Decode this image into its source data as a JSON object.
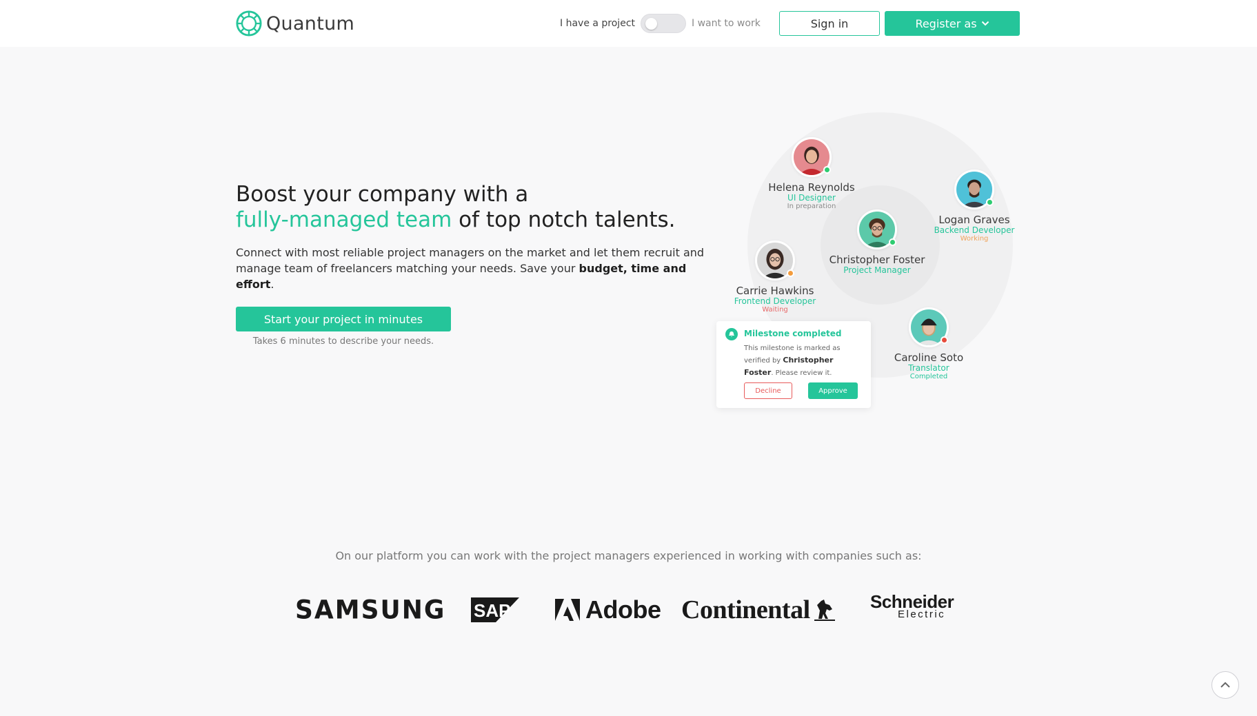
{
  "header": {
    "brand": "Quantum",
    "toggle_left": "I have a project",
    "toggle_right": "I want to work",
    "signin_label": "Sign in",
    "register_label": "Register as"
  },
  "hero": {
    "title_part1": "Boost your company with a",
    "title_accent": "fully-managed team",
    "title_part2": " of top notch talents.",
    "desc_part1": "Connect with most reliable project managers on the market and let them recruit and manage team of freelancers matching your needs. Save your ",
    "desc_bold": "budget, time and effort",
    "desc_end": ".",
    "cta_label": "Start your project in minutes",
    "cta_note": "Takes 6 minutes to describe your needs."
  },
  "people": [
    {
      "name": "Helena Reynolds",
      "role": "UI Designer",
      "state": "In preparation",
      "state_color": "#8a8a8a",
      "status_color": "#2ecc71"
    },
    {
      "name": "Logan Graves",
      "role": "Backend Developer",
      "state": "Working",
      "state_color": "#f0a35a",
      "status_color": "#2ecc71"
    },
    {
      "name": "Christopher Foster",
      "role": "Project Manager",
      "state": "",
      "state_color": "#8a8a8a",
      "status_color": "#2ecc71"
    },
    {
      "name": "Carrie Hawkins",
      "role": "Frontend Developer",
      "state": "Waiting",
      "state_color": "#e86a6a",
      "status_color": "#f39c3d"
    },
    {
      "name": "Caroline Soto",
      "role": "Translator",
      "state": "Completed",
      "state_color": "#25c59a",
      "status_color": "#e74c3c"
    }
  ],
  "notification": {
    "title": "Milestone completed",
    "text_part1": "This milestone is marked as verified by ",
    "text_bold": "Christopher Foster",
    "text_part2": ". Please review it.",
    "decline_label": "Decline",
    "approve_label": "Approve"
  },
  "companies": {
    "intro": "On our platform you can work with the project managers experienced in working with companies such as:",
    "logos": [
      "SAMSUNG",
      "SAP",
      "Adobe",
      "Continental",
      "Schneider",
      "Electric"
    ]
  },
  "colors": {
    "accent": "#25c59a",
    "background": "#f8f8f9",
    "decline": "#e85a5a"
  }
}
